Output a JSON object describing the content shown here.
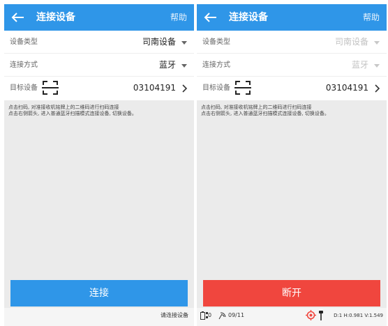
{
  "left": {
    "header": {
      "title": "连接设备",
      "help": "帮助"
    },
    "rows": [
      {
        "label": "设备类型",
        "value": "司南设备"
      },
      {
        "label": "连接方式",
        "value": "蓝牙"
      },
      {
        "label": "目标设备",
        "value": "03104191"
      }
    ],
    "hint_lines": [
      "点击扫码, 对准接收机铭牌上的二维码进行扫码连接",
      "点击右侧箭头, 进入普通蓝牙扫描模式连接设备, 切换设备。"
    ],
    "button": "连接",
    "footer_text": "请连接设备"
  },
  "right": {
    "header": {
      "title": "连接设备",
      "help": "帮助"
    },
    "rows": [
      {
        "label": "设备类型",
        "value": "司南设备"
      },
      {
        "label": "连接方式",
        "value": "蓝牙"
      },
      {
        "label": "目标设备",
        "value": "03104191"
      }
    ],
    "hint_lines": [
      "点击扫码, 对准接收机铭牌上的二维码进行扫码连接",
      "点击右侧箭头, 进入普通蓝牙扫描模式连接设备, 切换设备。"
    ],
    "button": "断开",
    "status": {
      "satellites": "0",
      "diff_age": "09/11",
      "coords": "D:1 H:0.981 V:1.549"
    }
  },
  "colors": {
    "header_blue": "#2f96e8",
    "disconnect_red": "#f0463e",
    "gps_orange": "#f0463e"
  },
  "icons": [
    "back-arrow-icon",
    "qr-scan-icon",
    "chevron-right-icon",
    "dropdown-caret-icon",
    "battery-icon",
    "satellite-icon",
    "diff-signal-icon",
    "gps-target-icon",
    "antenna-icon"
  ]
}
